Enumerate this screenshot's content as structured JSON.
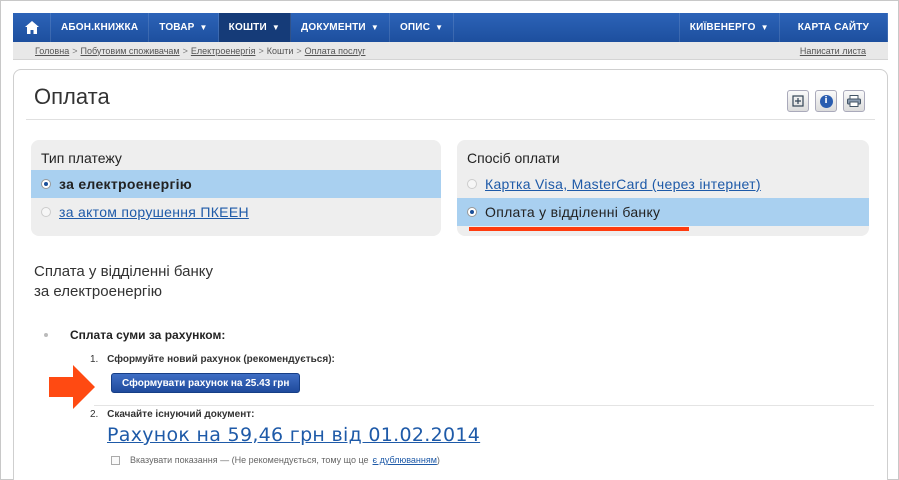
{
  "nav": {
    "home_icon": "home-icon",
    "items": [
      {
        "label": "АБОН.КНИЖКА",
        "caret": false,
        "active": false
      },
      {
        "label": "ТОВАР",
        "caret": true,
        "active": false
      },
      {
        "label": "КОШТИ",
        "caret": true,
        "active": true
      },
      {
        "label": "ДОКУМЕНТИ",
        "caret": true,
        "active": false
      },
      {
        "label": "ОПИС",
        "caret": true,
        "active": false
      }
    ],
    "right_items": [
      {
        "label": "КИЇВЕНЕРГО",
        "caret": true
      },
      {
        "label": "КАРТА САЙТУ",
        "caret": false
      }
    ]
  },
  "breadcrumb": {
    "items": [
      "Головна",
      "Побутовим споживачам",
      "Електроенергія",
      "Кошти",
      "Оплата послуг"
    ],
    "separator": ">",
    "right_link": "Написати листа"
  },
  "page": {
    "title": "Оплата",
    "tools": [
      "expand-icon",
      "info-icon",
      "print-icon"
    ]
  },
  "payment_type": {
    "heading": "Тип платежу",
    "options": [
      {
        "label": "за електроенергію",
        "selected": true
      },
      {
        "label": "за актом порушення ПКЕЕН",
        "selected": false
      }
    ]
  },
  "payment_method": {
    "heading": "Спосіб оплати",
    "options": [
      {
        "label": "Картка Visa, MasterCard (через інтернет)",
        "selected": false
      },
      {
        "label": "Оплата у відділенні банку",
        "selected": true
      }
    ]
  },
  "section": {
    "title_line1": "Сплата у відділенні банку",
    "title_line2": "за електроенергію",
    "bullet": "Сплата суми за рахунком:",
    "step1_num": "1.",
    "step1_label": "Сформуйте новий рахунок (рекомендується):",
    "generate_button": "Сформувати рахунок на 25.43 грн",
    "step2_num": "2.",
    "step2_label": "Скачайте існуючий документ:",
    "invoice_link": "Рахунок на 59,46 грн від 01.02.2014",
    "checkbox_label": "Вказувати показання — (Не рекомендується, тому що це",
    "checkbox_link": "є дублюванням",
    "checkbox_tail": ")"
  },
  "colors": {
    "nav_bg": "#1d4f9e",
    "selected_row": "#a9d0f0",
    "link": "#1e5aa8",
    "highlight": "#ff3b0f"
  }
}
